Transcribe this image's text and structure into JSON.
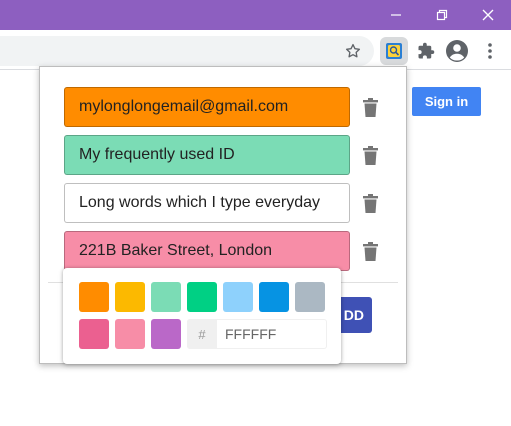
{
  "browser": {
    "colors": {
      "titlebar": "#8d5fc0",
      "toolbar": "#ffffff",
      "omnibox": "#f1f3f4"
    },
    "window_controls": [
      {
        "name": "minimize-icon"
      },
      {
        "name": "restore-icon"
      },
      {
        "name": "close-icon"
      }
    ],
    "toolbar_icons": [
      "star-icon",
      "extension-icon",
      "puzzle-icon",
      "profile-icon",
      "kebab-menu-icon"
    ]
  },
  "page": {
    "signin_label": "Sign in",
    "signin_color": "#4184f3"
  },
  "popup": {
    "entries": [
      {
        "text": "mylonglongemail@gmail.com",
        "color": "#ff8c00"
      },
      {
        "text": "My frequently used ID",
        "color": "#7bdcb5"
      },
      {
        "text": "Long words which I type everyday",
        "color": "#ffffff"
      },
      {
        "text": "221B Baker Street, London",
        "color": "#f78da7"
      }
    ],
    "add_button_label": "DD",
    "add_button_color": "#3f51b5",
    "color_picker": {
      "swatches": [
        "#ff8c00",
        "#fcb900",
        "#7bdcb5",
        "#00d084",
        "#8ed1fc",
        "#0693e3",
        "#abb8c3",
        "#eb6090",
        "#f78da7",
        "#ba68c8"
      ],
      "hash_label": "#",
      "hex_placeholder": "FFFFFF"
    }
  }
}
